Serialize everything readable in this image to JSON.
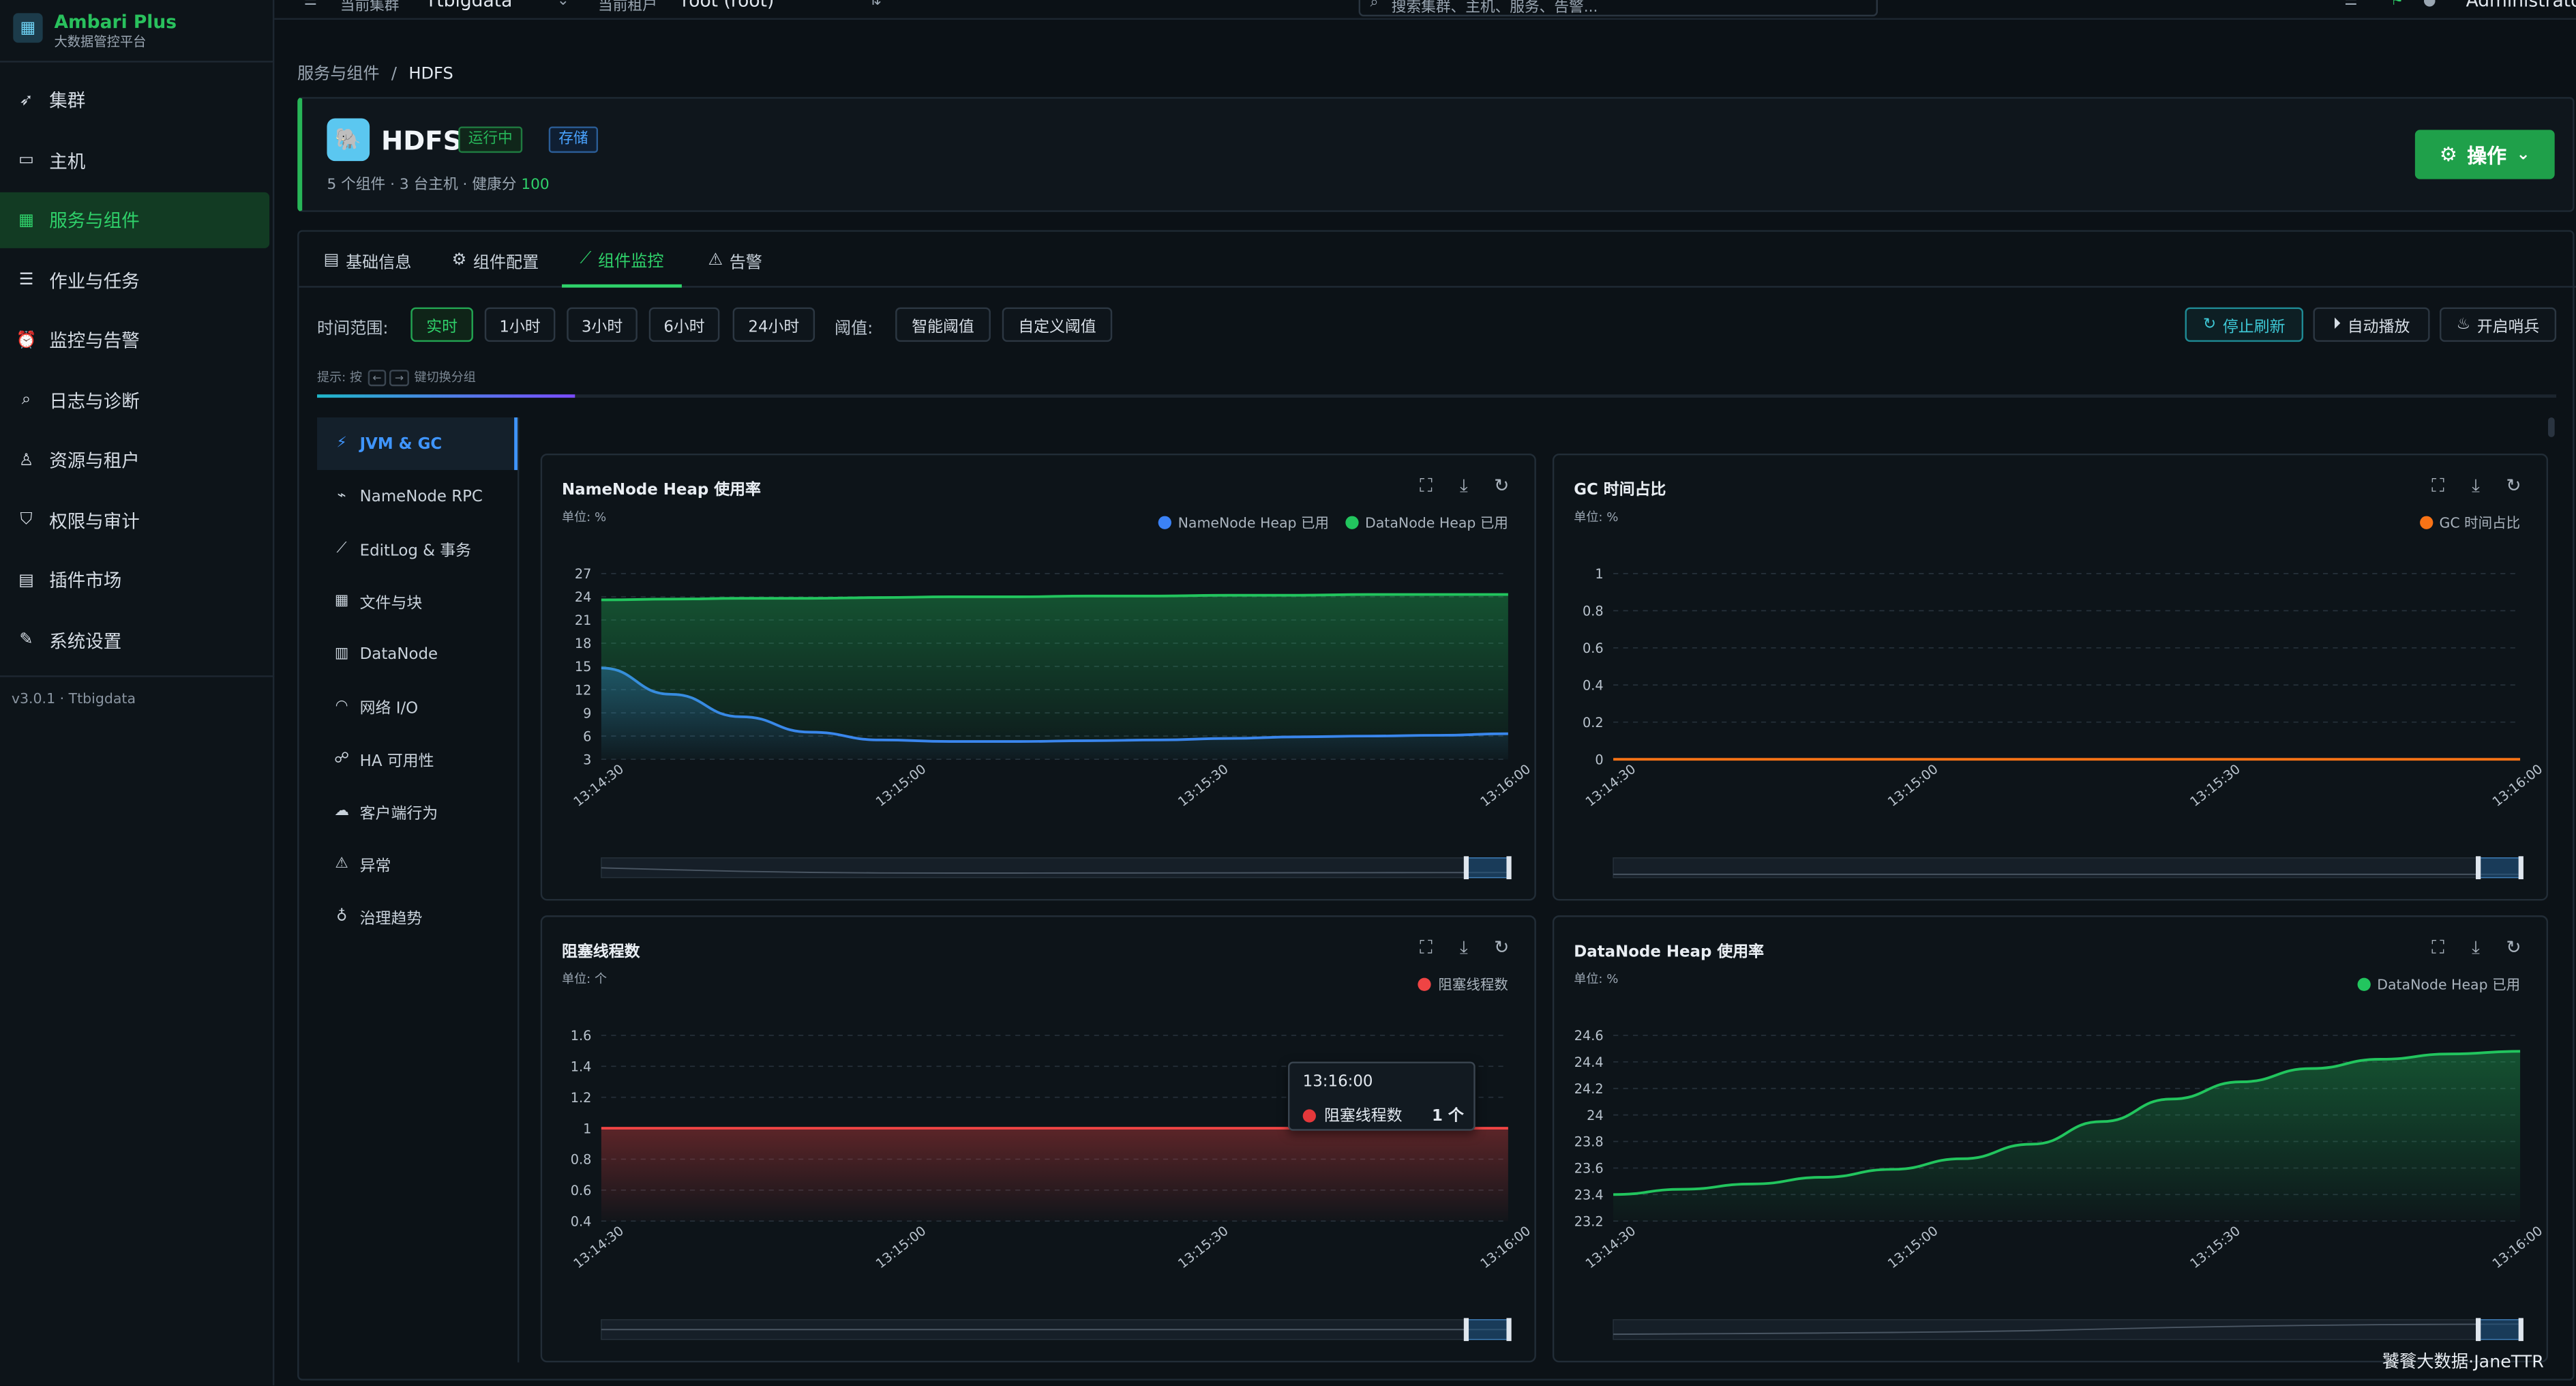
{
  "app": {
    "name": "Ambari Plus",
    "subtitle": "大数据管控平台",
    "version": "v3.0.1 · Ttbigdata"
  },
  "topbar": {
    "cluster_label": "当前集群",
    "cluster_value": "Ttbigdata",
    "tenant_label": "当前租户",
    "tenant_value": "root (root)",
    "search_placeholder": "搜索集群、主机、服务、告警...",
    "user": "Administrator"
  },
  "sidebar": {
    "items": [
      {
        "label": "集群",
        "icon": "rocket-icon"
      },
      {
        "label": "主机",
        "icon": "monitor-icon"
      },
      {
        "label": "服务与组件",
        "icon": "grid-icon",
        "active": true
      },
      {
        "label": "作业与任务",
        "icon": "list-icon"
      },
      {
        "label": "监控与告警",
        "icon": "alarm-icon"
      },
      {
        "label": "日志与诊断",
        "icon": "search-doc-icon"
      },
      {
        "label": "资源与租户",
        "icon": "users-icon"
      },
      {
        "label": "权限与审计",
        "icon": "shield-icon"
      },
      {
        "label": "插件市场",
        "icon": "apps-icon"
      },
      {
        "label": "系统设置",
        "icon": "wrench-icon"
      }
    ]
  },
  "breadcrumb": {
    "parent": "服务与组件",
    "separator": "/",
    "current": "HDFS"
  },
  "service": {
    "name": "HDFS",
    "status_badge": "运行中",
    "type_badge": "存储",
    "meta": "5 个组件 · 3 台主机 · 健康分",
    "health_score": "100",
    "action_button": "操作"
  },
  "tabs": [
    {
      "label": "基础信息",
      "icon": "doc-icon"
    },
    {
      "label": "组件配置",
      "icon": "gear-icon"
    },
    {
      "label": "组件监控",
      "icon": "chart-icon",
      "active": true
    },
    {
      "label": "告警",
      "icon": "warning-icon"
    }
  ],
  "toolbar": {
    "range_label": "时间范围:",
    "ranges": [
      "实时",
      "1小时",
      "3小时",
      "6小时",
      "24小时"
    ],
    "threshold_label": "阈值:",
    "thresholds": [
      "智能阈值",
      "自定义阈值"
    ],
    "stop_refresh": "停止刷新",
    "auto_play": "自动播放",
    "sentinel": "开启哨兵",
    "hint_prefix": "提示: 按",
    "hint_keys": [
      "←",
      "→"
    ],
    "hint_suffix": "键切换分组",
    "progress": 0.115
  },
  "groups": [
    {
      "label": "JVM & GC",
      "icon": "bolt-icon",
      "active": true
    },
    {
      "label": "NameNode RPC",
      "icon": "plug-icon"
    },
    {
      "label": "EditLog & 事务",
      "icon": "line-chart-icon"
    },
    {
      "label": "文件与块",
      "icon": "grid-icon"
    },
    {
      "label": "DataNode",
      "icon": "db-icon"
    },
    {
      "label": "网络 I/O",
      "icon": "wifi-icon"
    },
    {
      "label": "HA 可用性",
      "icon": "topology-icon"
    },
    {
      "label": "客户端行为",
      "icon": "cloud-icon"
    },
    {
      "label": "异常",
      "icon": "warning-icon"
    },
    {
      "label": "治理趋势",
      "icon": "bulb-icon"
    }
  ],
  "chart_data": [
    {
      "type": "area",
      "title": "NameNode Heap 使用率",
      "unit": "单位: %",
      "x": [
        "13:14:30",
        "13:15:00",
        "13:15:30",
        "13:16:00"
      ],
      "y_ticks": [
        3,
        6,
        9,
        12,
        15,
        18,
        21,
        24,
        27
      ],
      "ylim": [
        3,
        27
      ],
      "series": [
        {
          "name": "NameNode Heap 已用",
          "color": "#3b82f6",
          "values": [
            14.8,
            11.4,
            8.5,
            6.5,
            5.5,
            5.3,
            5.3,
            5.4,
            5.5,
            5.7,
            5.9,
            6.0,
            6.1,
            6.3
          ]
        },
        {
          "name": "DataNode Heap 已用",
          "color": "#22c55e",
          "values": [
            23.6,
            23.7,
            23.8,
            23.8,
            23.9,
            24.0,
            24.0,
            24.1,
            24.1,
            24.2,
            24.2,
            24.3,
            24.3,
            24.3
          ]
        }
      ],
      "legend": "top-right",
      "grid": true
    },
    {
      "type": "line",
      "title": "GC 时间占比",
      "unit": "单位: %",
      "x": [
        "13:14:30",
        "13:15:00",
        "13:15:30",
        "13:16:00"
      ],
      "y_ticks": [
        0,
        0.2,
        0.4,
        0.6,
        0.8,
        1
      ],
      "ylim": [
        0,
        1
      ],
      "series": [
        {
          "name": "GC 时间占比",
          "color": "#f97316",
          "values": [
            0,
            0,
            0,
            0,
            0,
            0,
            0,
            0,
            0,
            0,
            0,
            0,
            0,
            0
          ]
        }
      ],
      "legend": "top-right",
      "grid": true
    },
    {
      "type": "area",
      "title": "阻塞线程数",
      "unit": "单位: 个",
      "x": [
        "13:14:30",
        "13:15:00",
        "13:15:30",
        "13:16:00"
      ],
      "y_ticks": [
        0.4,
        0.6,
        0.8,
        1,
        1.2,
        1.4,
        1.6
      ],
      "ylim": [
        0.4,
        1.6
      ],
      "series": [
        {
          "name": "阻塞线程数",
          "color": "#ef4444",
          "values": [
            1,
            1,
            1,
            1,
            1,
            1,
            1,
            1,
            1,
            1,
            1,
            1,
            1,
            1
          ]
        }
      ],
      "tooltip": {
        "time": "13:16:00",
        "series": "阻塞线程数",
        "value": "1 个"
      },
      "legend": "top-right",
      "grid": true
    },
    {
      "type": "area",
      "title": "DataNode Heap 使用率",
      "unit": "单位: %",
      "x": [
        "13:14:30",
        "13:15:00",
        "13:15:30",
        "13:16:00"
      ],
      "y_ticks": [
        23.2,
        23.4,
        23.6,
        23.8,
        24,
        24.2,
        24.4,
        24.6
      ],
      "ylim": [
        23.2,
        24.6
      ],
      "series": [
        {
          "name": "DataNode Heap 已用",
          "color": "#22c55e",
          "values": [
            23.4,
            23.44,
            23.48,
            23.53,
            23.59,
            23.67,
            23.78,
            23.95,
            24.12,
            24.25,
            24.35,
            24.42,
            24.46,
            24.48
          ]
        }
      ],
      "legend": "top-right",
      "grid": true
    }
  ],
  "watermark": "饕餮大数据·JaneTTR"
}
